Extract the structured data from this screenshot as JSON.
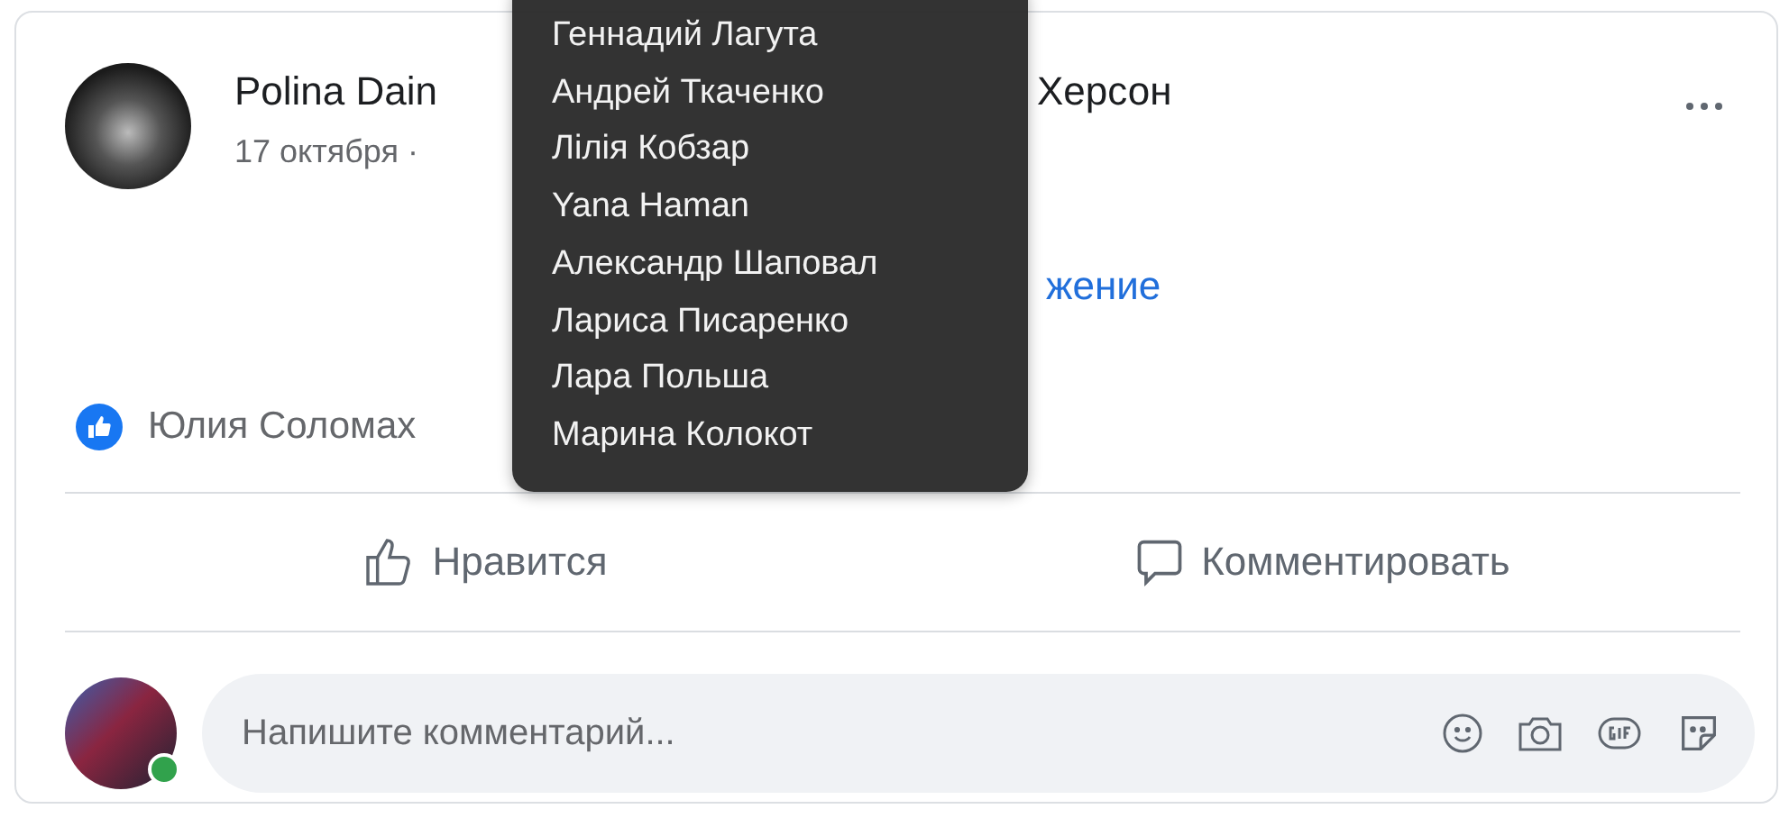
{
  "post": {
    "author_visible": "Polina Dain",
    "group_visible": "Херсон",
    "date": "17 октября ·",
    "attachment_link_visible": "жение",
    "reactions_text_visible": "Юлия Соломах"
  },
  "tooltip": {
    "names": [
      "Геннадий Лагута",
      "Андрей Ткаченко",
      "Лілія Кобзар",
      "Yana Haman",
      "Александр Шаповал",
      "Лариса Писаренко",
      "Лара Польша",
      "Марина Колокот"
    ]
  },
  "actions": [
    {
      "kind": "like",
      "label": "Нравится"
    },
    {
      "kind": "comment",
      "label": "Комментировать"
    }
  ],
  "comment_box": {
    "placeholder": "Напишите комментарий...",
    "online": true
  }
}
